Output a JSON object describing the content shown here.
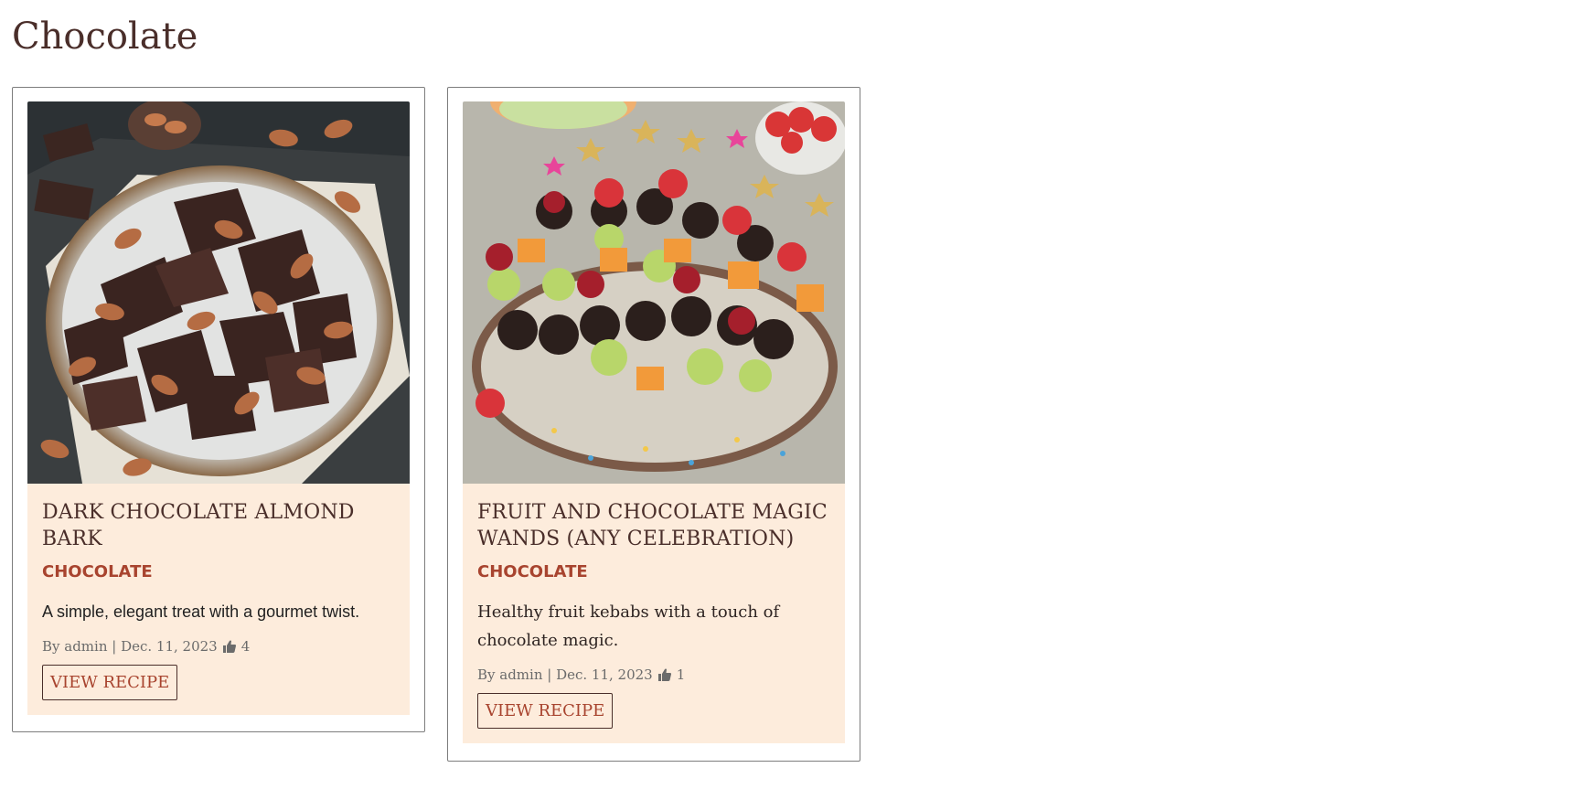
{
  "page": {
    "title": "Chocolate"
  },
  "cards": [
    {
      "title": "DARK CHOCOLATE ALMOND BARK",
      "category": "CHOCOLATE",
      "description": "A simple, elegant treat with a gourmet twist.",
      "meta_prefix": "By admin | Dec. 11, 2023",
      "likes": "4",
      "button_label": "VIEW RECIPE",
      "image_icon": "chocolate-almond-photo"
    },
    {
      "title": "FRUIT AND CHOCOLATE MAGIC WANDS (ANY CELEBRATION)",
      "category": "CHOCOLATE",
      "description": "Healthy fruit kebabs with a touch of chocolate magic.",
      "meta_prefix": "By admin | Dec. 11, 2023",
      "likes": "1",
      "button_label": "VIEW RECIPE",
      "image_icon": "fruit-kebab-photo"
    }
  ],
  "colors": {
    "title": "#4a2e2a",
    "category": "#a8442f",
    "card_body_bg": "#fdecdc"
  }
}
